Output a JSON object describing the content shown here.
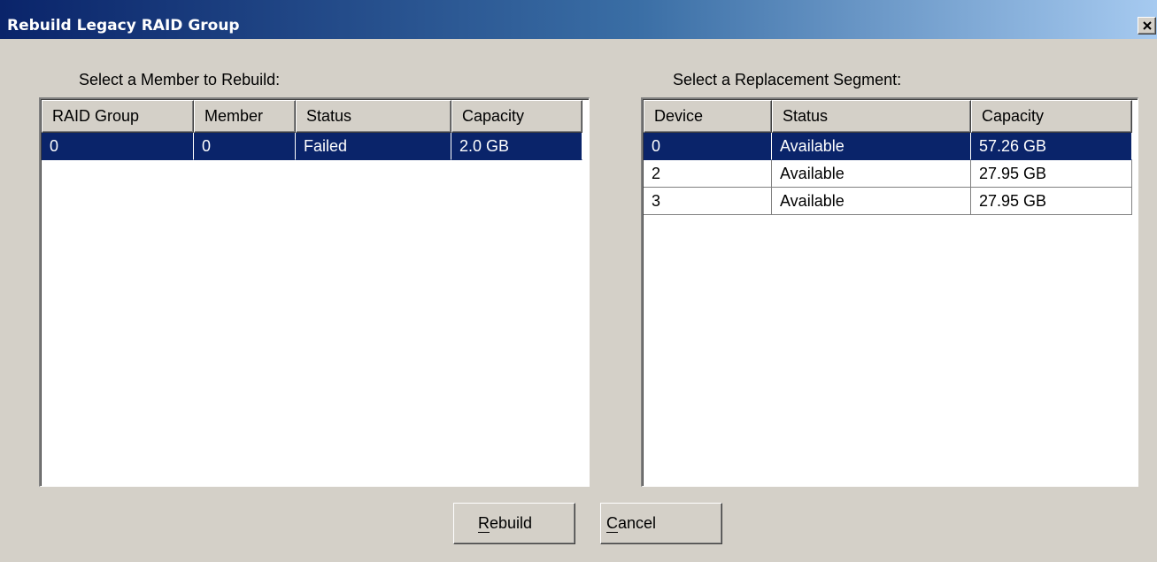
{
  "window": {
    "title": "Rebuild Legacy RAID Group",
    "close_icon": "close-x-icon"
  },
  "members": {
    "label": "Select a Member to Rebuild:",
    "columns": [
      "RAID Group",
      "Member",
      "Status",
      "Capacity"
    ],
    "rows": [
      {
        "raid_group": "0",
        "member": "0",
        "status": "Failed",
        "capacity": "2.0 GB",
        "selected": true
      }
    ]
  },
  "segments": {
    "label": "Select a Replacement Segment:",
    "columns": [
      "Device",
      "Status",
      "Capacity"
    ],
    "rows": [
      {
        "device": "0",
        "status": "Available",
        "capacity": "57.26 GB",
        "selected": true
      },
      {
        "device": "2",
        "status": "Available",
        "capacity": "27.95 GB",
        "selected": false
      },
      {
        "device": "3",
        "status": "Available",
        "capacity": "27.95 GB",
        "selected": false
      }
    ]
  },
  "buttons": {
    "rebuild": "Rebuild",
    "cancel": "Cancel"
  },
  "colors": {
    "selection": "#0a246a",
    "title_gradient_start": "#0a246a",
    "title_gradient_end": "#a6caf0",
    "face": "#d4d0c8"
  }
}
